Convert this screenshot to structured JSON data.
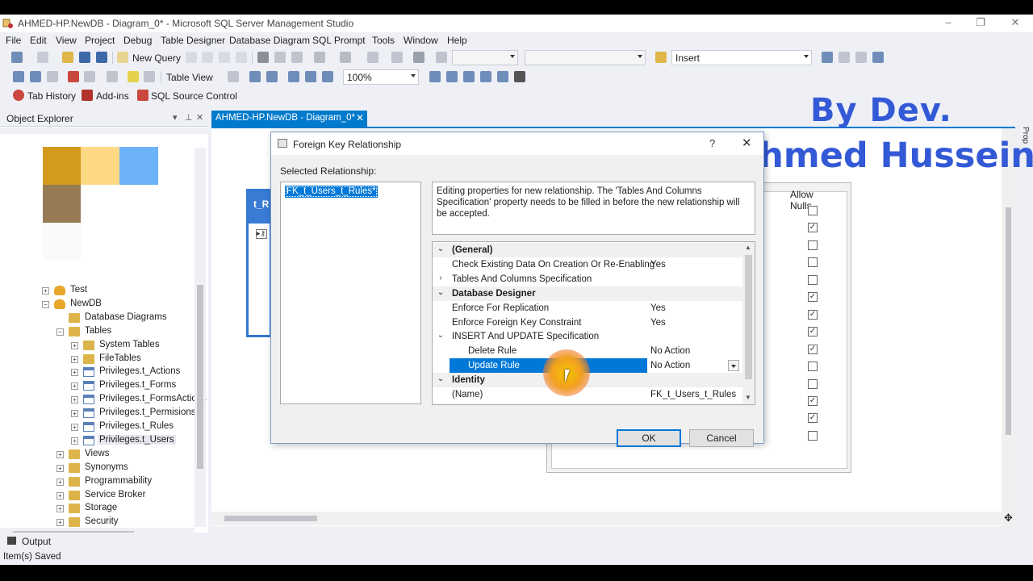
{
  "window": {
    "title": "AHMED-HP.NewDB - Diagram_0* - Microsoft SQL Server Management Studio",
    "controls": [
      "–",
      "❐",
      "✕"
    ]
  },
  "menu": [
    "File",
    "Edit",
    "View",
    "Project",
    "Debug",
    "Table Designer",
    "Database Diagram",
    "SQL Prompt",
    "Tools",
    "Window",
    "Help"
  ],
  "toolbar1": {
    "new_query": "New Query",
    "insert_combo": "Insert"
  },
  "toolbar2": {
    "table_view": "Table View",
    "zoom": "100%"
  },
  "toolbar3": {
    "tab_history": "Tab History",
    "addins": "Add-ins",
    "sql_source_control": "SQL Source Control"
  },
  "object_explorer": {
    "title": "Object Explorer",
    "items": [
      {
        "label": "Test",
        "indent": 0,
        "exp": "+",
        "icon": "database"
      },
      {
        "label": "NewDB",
        "indent": 0,
        "exp": "−",
        "icon": "database"
      },
      {
        "label": "Database Diagrams",
        "indent": 1,
        "exp": "",
        "icon": "folder"
      },
      {
        "label": "Tables",
        "indent": 1,
        "exp": "−",
        "icon": "folder"
      },
      {
        "label": "System Tables",
        "indent": 2,
        "exp": "+",
        "icon": "folder"
      },
      {
        "label": "FileTables",
        "indent": 2,
        "exp": "+",
        "icon": "folder"
      },
      {
        "label": "Privileges.t_Actions",
        "indent": 2,
        "exp": "+",
        "icon": "table"
      },
      {
        "label": "Privileges.t_Forms",
        "indent": 2,
        "exp": "+",
        "icon": "table"
      },
      {
        "label": "Privileges.t_FormsActions",
        "indent": 2,
        "exp": "+",
        "icon": "table"
      },
      {
        "label": "Privileges.t_Permisions",
        "indent": 2,
        "exp": "+",
        "icon": "table"
      },
      {
        "label": "Privileges.t_Rules",
        "indent": 2,
        "exp": "+",
        "icon": "table"
      },
      {
        "label": "Privileges.t_Users",
        "indent": 2,
        "exp": "+",
        "icon": "table"
      },
      {
        "label": "Views",
        "indent": 1,
        "exp": "+",
        "icon": "folder"
      },
      {
        "label": "Synonyms",
        "indent": 1,
        "exp": "+",
        "icon": "folder"
      },
      {
        "label": "Programmability",
        "indent": 1,
        "exp": "+",
        "icon": "folder"
      },
      {
        "label": "Service Broker",
        "indent": 1,
        "exp": "+",
        "icon": "folder"
      },
      {
        "label": "Storage",
        "indent": 1,
        "exp": "+",
        "icon": "folder"
      },
      {
        "label": "Security",
        "indent": 1,
        "exp": "+",
        "icon": "folder"
      }
    ]
  },
  "document_tab": "AHMED-HP.NewDB - Diagram_0*",
  "diagram": {
    "left_table_header": "t_R",
    "allow_nulls_header": "Allow Nulls",
    "allow_nulls": [
      false,
      true,
      false,
      false,
      false,
      true,
      true,
      true,
      true,
      false,
      false,
      true,
      true,
      false
    ]
  },
  "watermark": {
    "line1": "By Dev.",
    "line2": "Ahmed Hussein"
  },
  "right_strip": "Prop",
  "dialog": {
    "title": "Foreign Key Relationship",
    "help": "?",
    "close": "✕",
    "selected_label": "Selected Relationship:",
    "relationship": "FK_t_Users_t_Rules*",
    "description": "Editing properties for new relationship.  The 'Tables And Columns Specification' property needs to be filled in before the new relationship will be accepted.",
    "properties": [
      {
        "type": "cat",
        "exp": "⌄",
        "name": "(General)",
        "value": ""
      },
      {
        "type": "prop",
        "exp": "",
        "name": "Check Existing Data On Creation Or Re-Enabling",
        "value": "Yes",
        "indent": 0
      },
      {
        "type": "prop",
        "exp": "›",
        "name": "Tables And Columns Specification",
        "value": "",
        "indent": 0
      },
      {
        "type": "cat",
        "exp": "⌄",
        "name": "Database Designer",
        "value": ""
      },
      {
        "type": "prop",
        "exp": "",
        "name": "Enforce For Replication",
        "value": "Yes",
        "indent": 0
      },
      {
        "type": "prop",
        "exp": "",
        "name": "Enforce Foreign Key Constraint",
        "value": "Yes",
        "indent": 0
      },
      {
        "type": "prop",
        "exp": "⌄",
        "name": "INSERT And UPDATE Specification",
        "value": "",
        "indent": 0
      },
      {
        "type": "prop",
        "exp": "",
        "name": "Delete Rule",
        "value": "No Action",
        "indent": 1
      },
      {
        "type": "prop",
        "exp": "",
        "name": "Update Rule",
        "value": "No Action",
        "indent": 1,
        "selected": true
      },
      {
        "type": "cat",
        "exp": "⌄",
        "name": "Identity",
        "value": ""
      },
      {
        "type": "prop",
        "exp": "",
        "name": "(Name)",
        "value": "FK_t_Users_t_Rules",
        "indent": 0
      }
    ],
    "ok": "OK",
    "cancel": "Cancel"
  },
  "output_label": "Output",
  "status": "Item(s) Saved",
  "colors": {
    "accent": "#007acc",
    "selection": "#0078d7",
    "watermark": "#3359d6",
    "folder": "#dcb44a"
  }
}
